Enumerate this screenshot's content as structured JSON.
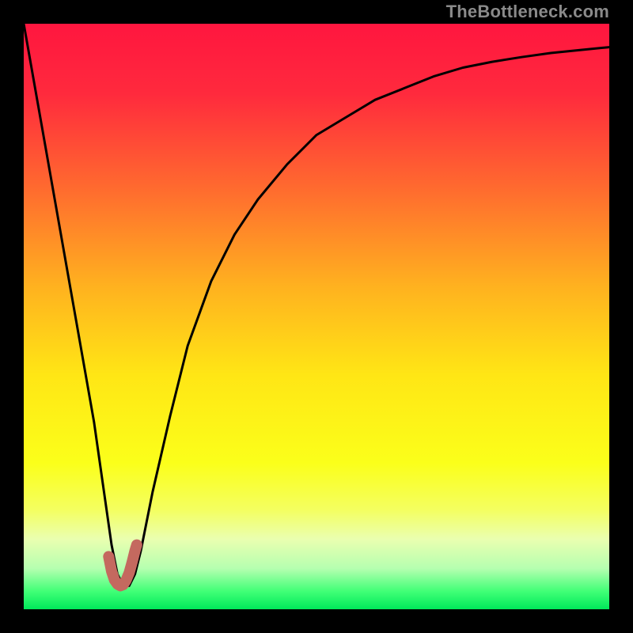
{
  "watermark": "TheBottleneck.com",
  "chart_data": {
    "type": "line",
    "title": "",
    "xlabel": "",
    "ylabel": "",
    "xlim": [
      0,
      100
    ],
    "ylim": [
      0,
      100
    ],
    "grid": false,
    "legend": false,
    "series": [
      {
        "name": "bottleneck-curve",
        "x": [
          0,
          3,
          6,
          9,
          12,
          14,
          15,
          16,
          17,
          18,
          19,
          20,
          22,
          25,
          28,
          32,
          36,
          40,
          45,
          50,
          55,
          60,
          65,
          70,
          75,
          80,
          85,
          90,
          95,
          100
        ],
        "y": [
          100,
          83,
          66,
          49,
          32,
          18,
          11,
          6,
          4,
          4,
          6,
          10,
          20,
          33,
          45,
          56,
          64,
          70,
          76,
          81,
          84,
          87,
          89,
          91,
          92.5,
          93.5,
          94.3,
          95,
          95.5,
          96
        ]
      },
      {
        "name": "optimal-marker",
        "x": [
          14.5,
          15,
          15.5,
          16,
          16.5,
          17,
          17.5,
          18,
          18.5,
          19,
          19.3
        ],
        "y": [
          9,
          6.5,
          5,
          4.3,
          4,
          4.2,
          5,
          6.2,
          8,
          10,
          11
        ]
      }
    ],
    "background_gradient_stops": [
      {
        "pct": 0,
        "color": "#ff163f"
      },
      {
        "pct": 12,
        "color": "#ff2a3d"
      },
      {
        "pct": 28,
        "color": "#ff6a2f"
      },
      {
        "pct": 45,
        "color": "#ffb21f"
      },
      {
        "pct": 60,
        "color": "#ffe615"
      },
      {
        "pct": 75,
        "color": "#fbff1a"
      },
      {
        "pct": 83,
        "color": "#f4ff60"
      },
      {
        "pct": 88,
        "color": "#eaffb0"
      },
      {
        "pct": 93,
        "color": "#b6ffb0"
      },
      {
        "pct": 97,
        "color": "#3fff76"
      },
      {
        "pct": 100,
        "color": "#00e85a"
      }
    ],
    "colors": {
      "curve": "#000000",
      "marker": "#c4695f"
    }
  }
}
